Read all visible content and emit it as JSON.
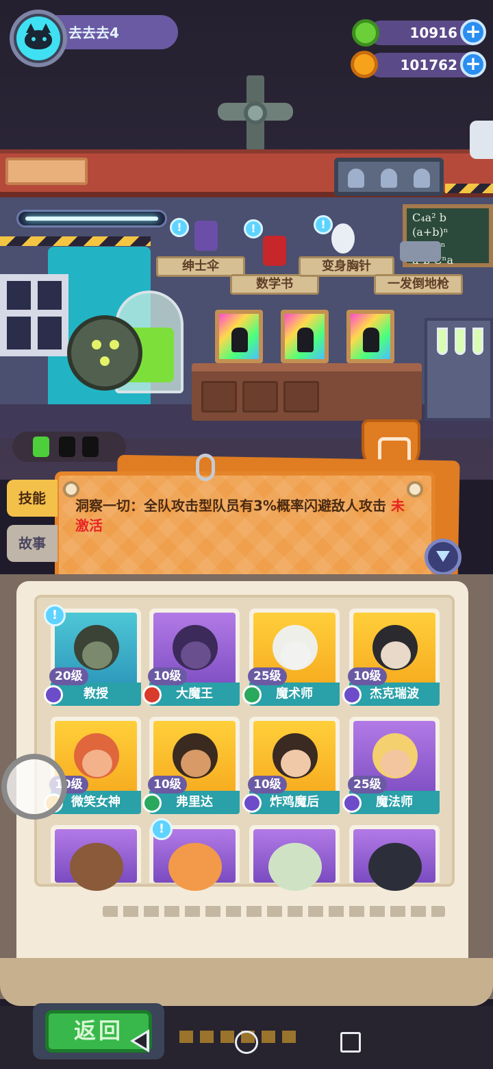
{
  "player": {
    "name": "去去去4",
    "avatar_icon": "cat-icon"
  },
  "currency": {
    "gems": {
      "value": "10916",
      "icon": "green-gem-icon"
    },
    "coins": {
      "value": "101762",
      "icon": "orange-planet-coin-icon"
    }
  },
  "scene_items": [
    {
      "label": "绅士伞",
      "icon": "umbrella-icon"
    },
    {
      "label": "数学书",
      "icon": "book-icon"
    },
    {
      "label": "变身胸针",
      "icon": "skull-brooch-icon"
    },
    {
      "label": "一发倒地枪",
      "icon": "gun-icon"
    }
  ],
  "chalkboard": {
    "line1": "C₄a²  b",
    "line2": "(a+b)ⁿ  CⁿbCⁿ",
    "line3": "   a²b   Cⁿa"
  },
  "side_tabs": {
    "skill": "技能",
    "story": "故事"
  },
  "skill": {
    "description": "洞察一切：全队攻击型队员有3%概率闪避敌人攻击",
    "status": "未激活"
  },
  "characters": [
    {
      "level": "20级",
      "name": "教授",
      "rank_color": "purple",
      "art": "teal",
      "alert": true
    },
    {
      "level": "10级",
      "name": "大魔王",
      "rank_color": "red",
      "art": "purple",
      "alert": false
    },
    {
      "level": "25级",
      "name": "魔术师",
      "rank_color": "green",
      "art": "gold",
      "alert": false
    },
    {
      "level": "10级",
      "name": "杰克瑞波",
      "rank_color": "purple",
      "art": "gold",
      "alert": false
    },
    {
      "level": "10级",
      "name": "微笑女神",
      "rank_color": "gold",
      "art": "gold",
      "alert": false
    },
    {
      "level": "10级",
      "name": "弗里达",
      "rank_color": "green",
      "art": "gold",
      "alert": false
    },
    {
      "level": "10级",
      "name": "炸鸡魔后",
      "rank_color": "purple",
      "art": "gold",
      "alert": false
    },
    {
      "level": "25级",
      "name": "魔法师",
      "rank_color": "purple",
      "art": "purple",
      "alert": false
    }
  ],
  "locked_characters": [
    {
      "art": "purple",
      "alert": false
    },
    {
      "art": "purple",
      "alert": true
    },
    {
      "art": "purple",
      "alert": false
    },
    {
      "art": "purple",
      "alert": false
    }
  ],
  "buttons": {
    "back": "返回"
  },
  "colors": {
    "accent_orange": "#f0a04c",
    "level_purple": "#6a5aa3",
    "name_teal": "#2aa0a8",
    "inactive_red": "#e82424",
    "back_green": "#38b84a"
  }
}
